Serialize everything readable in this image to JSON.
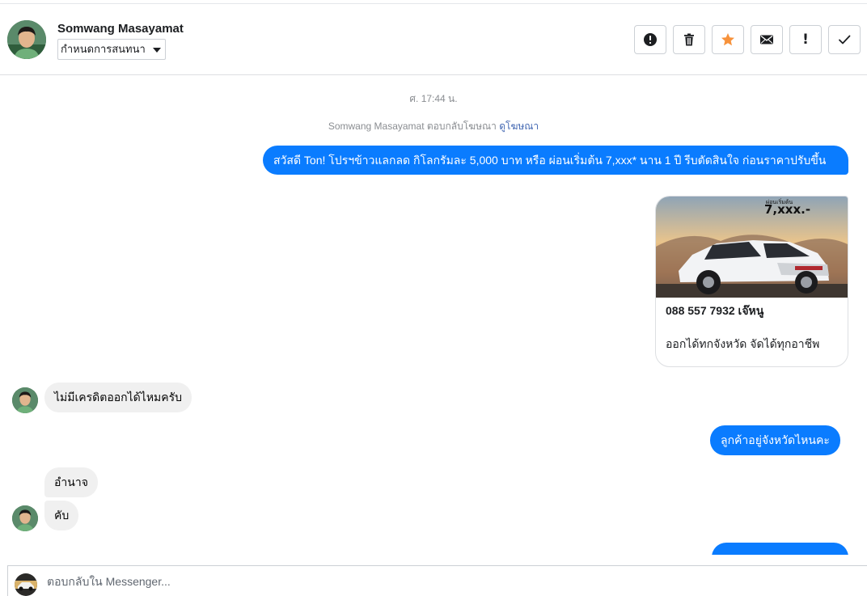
{
  "header": {
    "contact_name": "Somwang Masayamat",
    "label_dropdown": "กำหนดการสนทนา",
    "actions": [
      {
        "icon": "alert-circle-icon"
      },
      {
        "icon": "trash-icon"
      },
      {
        "icon": "star-icon",
        "active_color": "#f7923b"
      },
      {
        "icon": "envelope-icon"
      },
      {
        "icon": "exclamation-icon",
        "glyph": "!"
      },
      {
        "icon": "check-icon"
      }
    ]
  },
  "thread": {
    "timestamp": "ศ. 17:44 น.",
    "ad_reply_prefix": "Somwang Masayamat ตอบกลับโฆษณา",
    "ad_reply_link": "ดูโฆษณา",
    "messages": [
      {
        "from": "page",
        "text": "สวัสดี Ton! โปรฯข้าวแลกลด กิโลกรัมละ 5,000 บาท หรือ ผ่อนเริ่มต้น 7,xxx* นาน 1 ปี  รีบตัดสินใจ ก่อนราคาปรับขึ้น"
      },
      {
        "from": "page",
        "type": "card",
        "image_caption_small": "ผ่อนเริ่มต้น",
        "image_caption_big": "7,xxx.-",
        "title": "088 557 7932 เจ๊หนู",
        "description": "ออกได้ทกจังหวัด จัดได้ทุกอาชีพ"
      },
      {
        "from": "customer",
        "text": "ไม่มีเครดิตออกได้ไหมครับ"
      },
      {
        "from": "page",
        "text": "ลูกค้าอยู่จังหวัดไหนคะ"
      },
      {
        "from": "customer",
        "text": "อำนาจ"
      },
      {
        "from": "customer",
        "text": "คับ"
      },
      {
        "from": "page",
        "text": ""
      }
    ]
  },
  "composer": {
    "placeholder": "ตอบกลับใน Messenger..."
  },
  "colors": {
    "outgoing_bubble": "#0a7cff",
    "incoming_bubble": "#f0f0f0",
    "link": "#4267b2",
    "star_active": "#f7923b"
  }
}
